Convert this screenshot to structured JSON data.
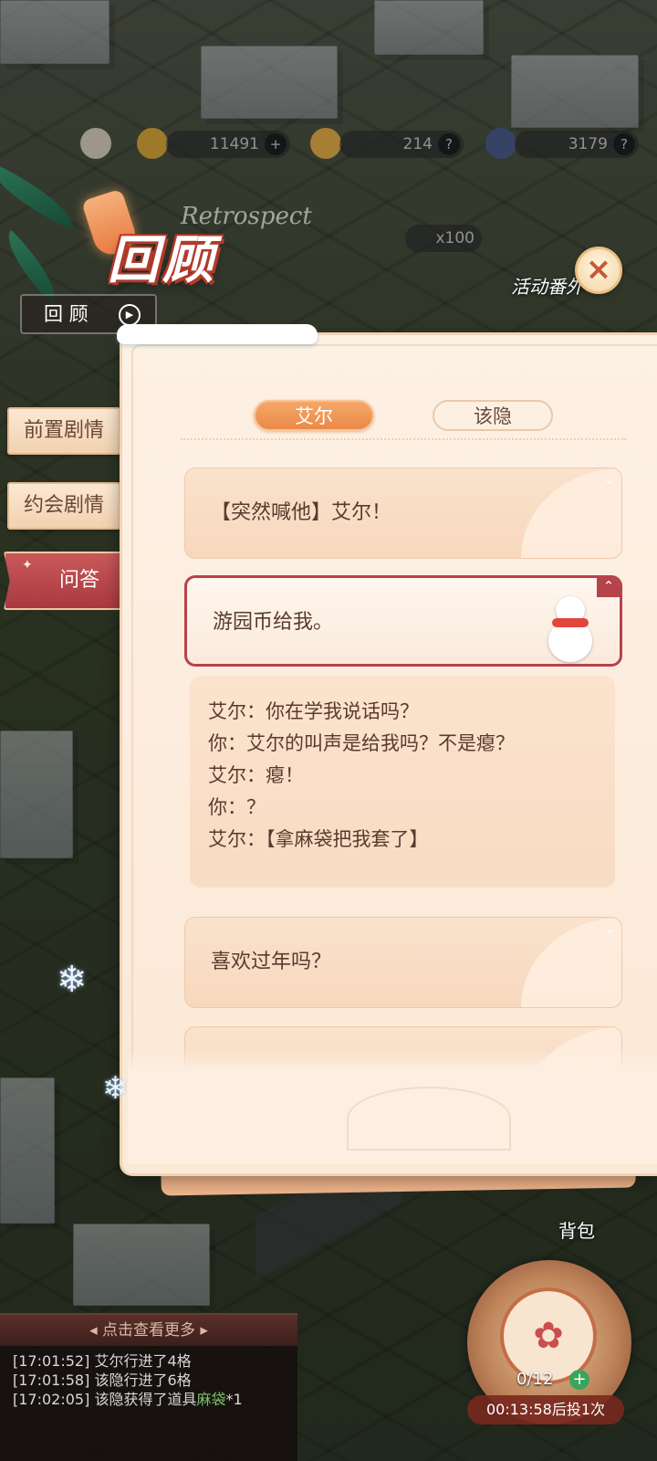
{
  "hud": {
    "coins": "11491",
    "coins_plus": "+",
    "tickets": "214",
    "tickets_help": "?",
    "points": "3179",
    "points_help": "?",
    "reward_count": "x100"
  },
  "header": {
    "title": "回顾",
    "subtitle": "Retrospect",
    "close_label": "×",
    "activity_label": "活动番外",
    "review_button": "回 顾"
  },
  "sidebar": {
    "items": [
      {
        "label": "前置剧情"
      },
      {
        "label": "约会剧情"
      },
      {
        "label": "问答"
      }
    ]
  },
  "tabs": {
    "left": "艾尔",
    "right": "该隐"
  },
  "questions": [
    {
      "text": "【突然喊他】艾尔！"
    },
    {
      "text": "游园币给我。"
    },
    {
      "text": "喜欢过年吗？"
    }
  ],
  "answer_lines": [
    "艾尔：你在学我说话吗？",
    "你：艾尔的叫声是给我吗？不是瘪？",
    "艾尔：瘪！",
    "你：？",
    "艾尔：【拿麻袋把我套了】"
  ],
  "log": {
    "header": "点击查看更多",
    "entries": [
      {
        "time": "[17:01:52]",
        "text": "艾尔行进了4格",
        "item": ""
      },
      {
        "time": "[17:01:58]",
        "text": "该隐行进了6格",
        "item": ""
      },
      {
        "time": "[17:02:05]",
        "text": "该隐获得了道具",
        "item": "麻袋",
        "suffix": "*1"
      }
    ]
  },
  "dice": {
    "count": "0/12",
    "plus": "+",
    "timer": "00:13:58后投1次"
  },
  "bag_label": "背包",
  "colors": {
    "accent_red": "#b6424a",
    "accent_orange": "#ea8a48",
    "panel_bg": "#fdf1e4",
    "card_bg": "#f7d8bd"
  }
}
